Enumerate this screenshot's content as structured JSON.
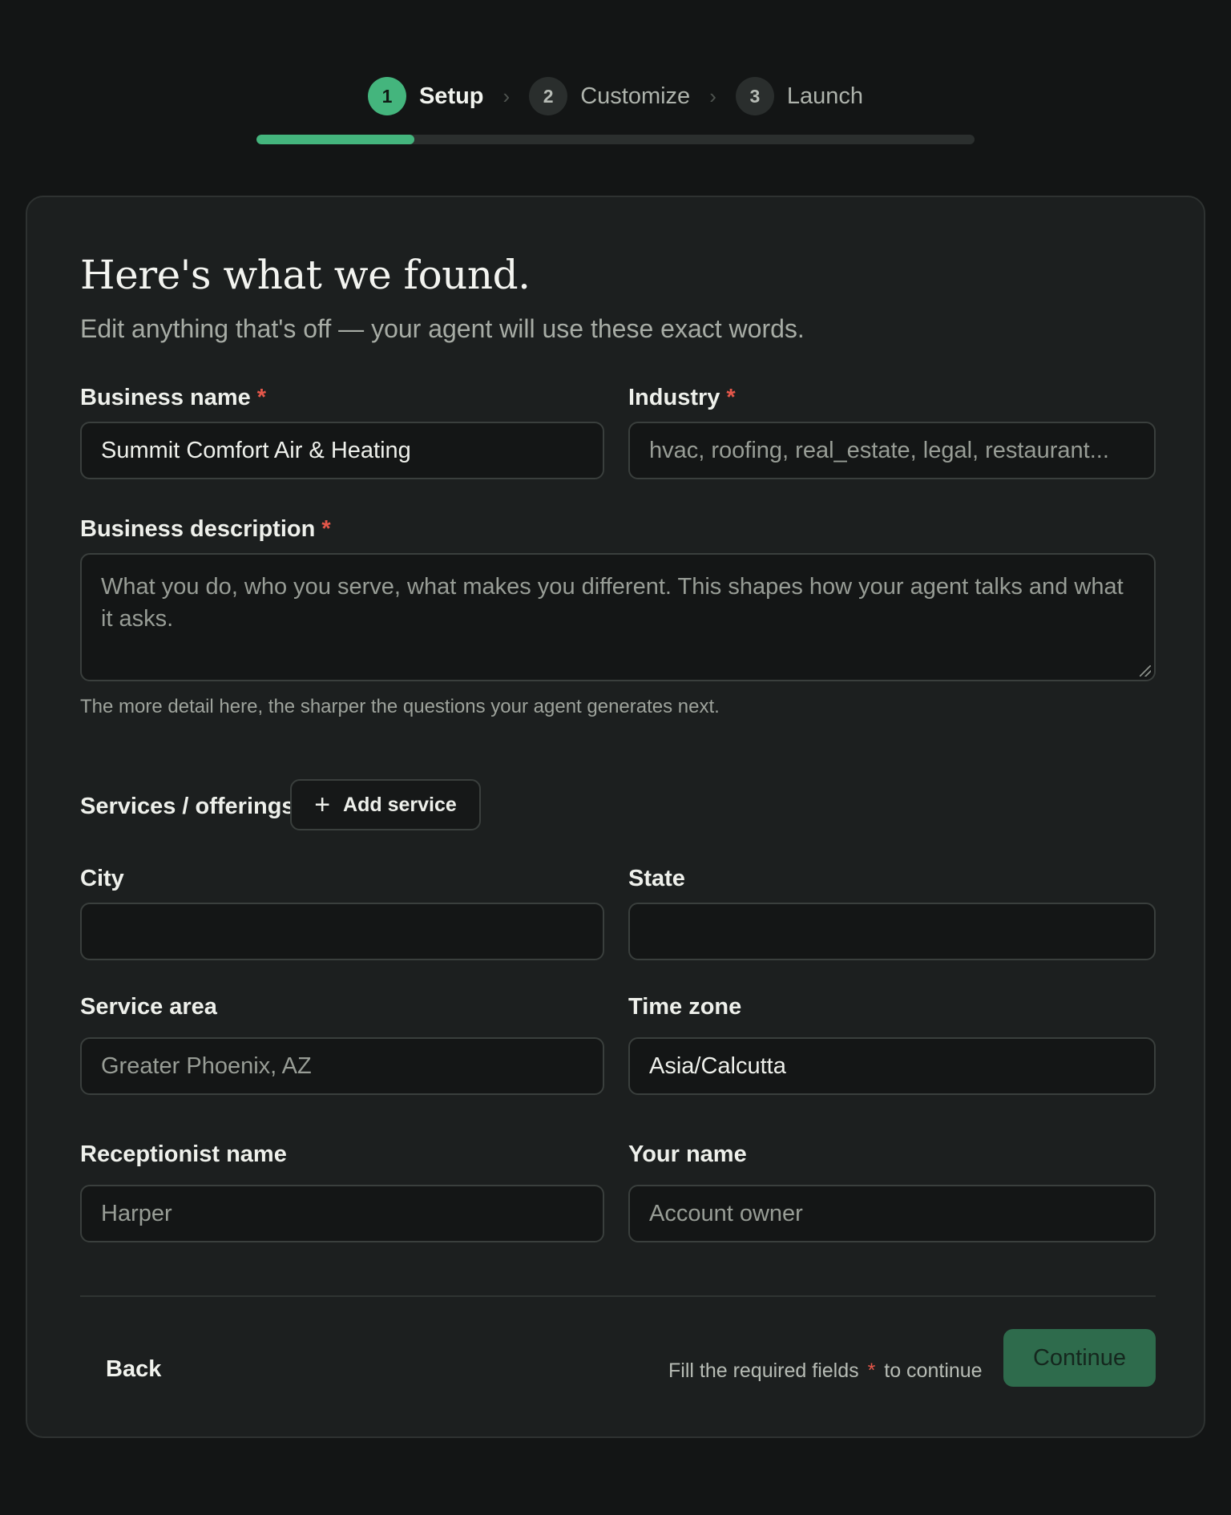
{
  "stepper": {
    "steps": [
      {
        "number": "1",
        "label": "Setup",
        "active": true
      },
      {
        "number": "2",
        "label": "Customize",
        "active": false
      },
      {
        "number": "3",
        "label": "Launch",
        "active": false
      }
    ],
    "separator": "›",
    "progress_fraction": 0.22
  },
  "heading": "Here's what we found.",
  "subheading": "Edit anything that's off — your agent will use these exact words.",
  "fields": {
    "business_name": {
      "label": "Business name",
      "required_mark": "*",
      "value": "Summit Comfort Air & Heating"
    },
    "industry": {
      "label": "Industry",
      "required_mark": "*",
      "placeholder": "hvac, roofing, real_estate, legal, restaurant..."
    },
    "business_description": {
      "label": "Business description",
      "required_mark": "*",
      "placeholder": "What you do, who you serve, what makes you different. This shapes how your agent talks and what it asks.",
      "hint": "The more detail here, the sharper the questions your agent generates next."
    },
    "services": {
      "label": "Services / offerings",
      "add_button": "Add service",
      "add_icon": "plus-icon"
    },
    "city": {
      "label": "City",
      "value": ""
    },
    "state": {
      "label": "State",
      "value": ""
    },
    "service_area": {
      "label": "Service area",
      "placeholder": "Greater Phoenix, AZ"
    },
    "time_zone": {
      "label": "Time zone",
      "value": "Asia/Calcutta"
    },
    "receptionist_name": {
      "label": "Receptionist name",
      "placeholder": "Harper"
    },
    "your_name": {
      "label": "Your name",
      "placeholder": "Account owner"
    }
  },
  "footer": {
    "back": "Back",
    "required_hint_before": "Fill the required fields",
    "required_hint_mark": "*",
    "required_hint_after": "to continue",
    "continue": "Continue"
  },
  "colors": {
    "accent": "#44b57d",
    "continue_disabled": "#2e6b4c",
    "required": "#e5574a",
    "background": "#131515",
    "card": "#1c1f1f"
  }
}
